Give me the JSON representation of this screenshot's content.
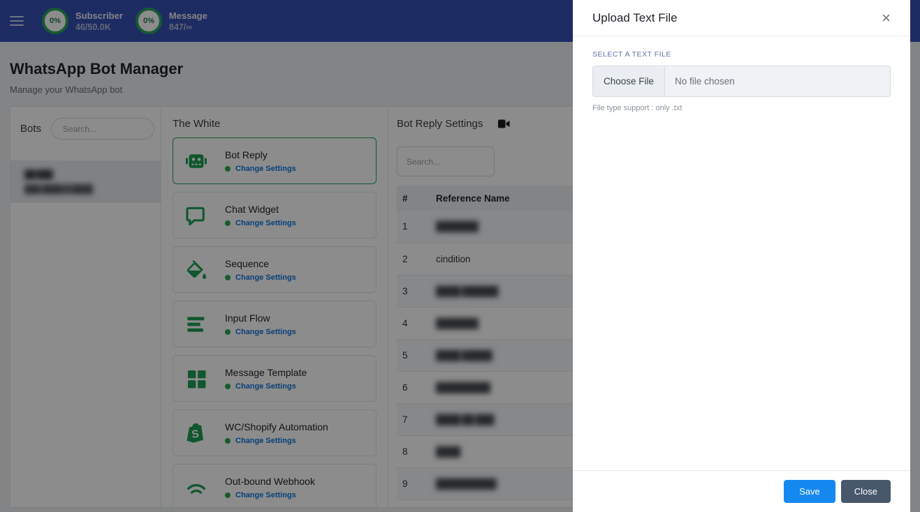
{
  "colors": {
    "navbar": "#3350b4",
    "icon_green": "#1e9e57",
    "ring_green": "#2ba35e",
    "link_blue": "#1275d8",
    "save_blue": "#1588ef",
    "close_slate": "#47586d",
    "field_label_indigo": "#6570a8"
  },
  "navbar": {
    "menu_icon": "hamburger",
    "stats": [
      {
        "percent": "0%",
        "label": "Subscriber",
        "value": "46/50.0K"
      },
      {
        "percent": "0%",
        "label": "Message",
        "value": "847/∞"
      }
    ]
  },
  "page": {
    "title": "WhatsApp Bot Manager",
    "subtitle": "Manage your WhatsApp bot"
  },
  "bots_panel": {
    "title": "Bots",
    "search_placeholder": "Search...",
    "selected_bot": {
      "name_masked": "██ ███",
      "phone_masked": "███ ████ █ ████",
      "redacted": true
    }
  },
  "features_panel": {
    "title": "The White",
    "change_settings_label": "Change Settings",
    "cards": [
      {
        "name": "Bot Reply",
        "icon": "robot-icon",
        "selected": true
      },
      {
        "name": "Chat Widget",
        "icon": "chat-bubble-icon",
        "selected": false
      },
      {
        "name": "Sequence",
        "icon": "paint-bucket-icon",
        "selected": false
      },
      {
        "name": "Input Flow",
        "icon": "bars-icon",
        "selected": false
      },
      {
        "name": "Message Template",
        "icon": "grid-icon",
        "selected": false
      },
      {
        "name": "WC/Shopify Automation",
        "icon": "shopify-bag-icon",
        "selected": false
      },
      {
        "name": "Out-bound Webhook",
        "icon": "webhook-arcs-icon",
        "selected": false
      }
    ]
  },
  "settings_panel": {
    "title": "Bot Reply Settings",
    "title_icon": "video-camera-icon",
    "search_placeholder": "Search...",
    "table": {
      "columns": [
        "#",
        "Reference Name"
      ],
      "rows": [
        {
          "num": "1",
          "name": "███████",
          "redacted": true
        },
        {
          "num": "2",
          "name": "cindition",
          "redacted": false
        },
        {
          "num": "3",
          "name": "████ ██████",
          "redacted": true
        },
        {
          "num": "4",
          "name": "███████",
          "redacted": true
        },
        {
          "num": "5",
          "name": "████ █████",
          "redacted": true
        },
        {
          "num": "6",
          "name": "█████████",
          "redacted": true
        },
        {
          "num": "7",
          "name": "████ ██ ███",
          "redacted": true
        },
        {
          "num": "8",
          "name": "████",
          "redacted": true
        },
        {
          "num": "9",
          "name": "██████████",
          "redacted": true
        }
      ]
    }
  },
  "modal": {
    "title": "Upload Text File",
    "close_icon": "×",
    "field_label": "SELECT A TEXT FILE",
    "file_button": "Choose File",
    "file_status": "No file chosen",
    "hint": "File type support : only .txt",
    "save_label": "Save",
    "close_label": "Close"
  }
}
